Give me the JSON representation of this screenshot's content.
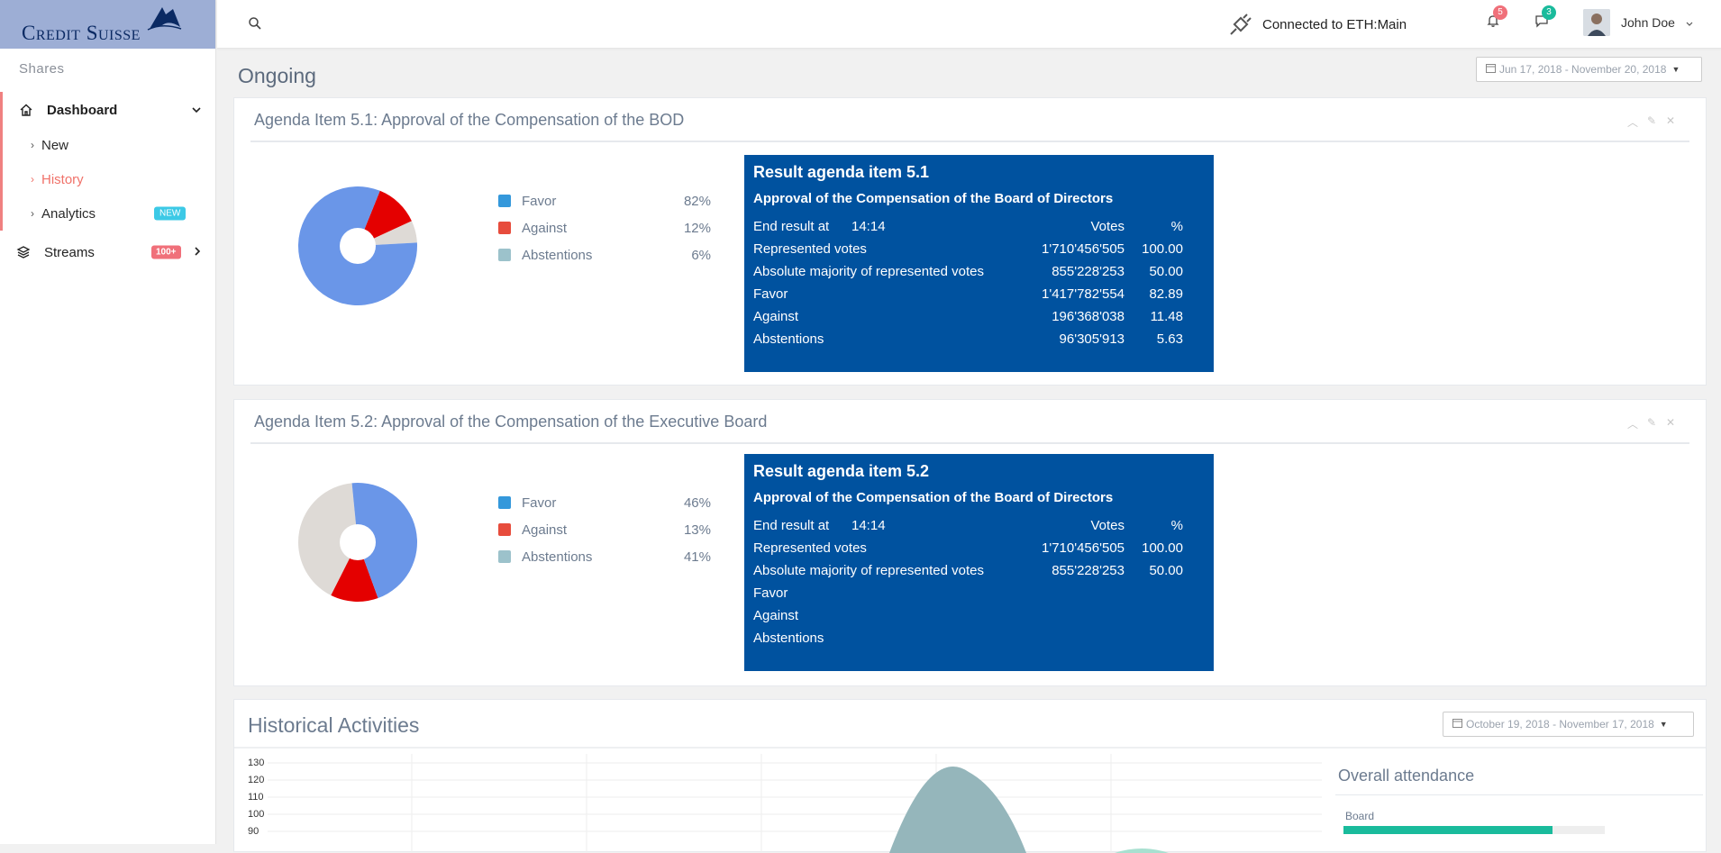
{
  "brand": {
    "name": "Credit Suisse"
  },
  "sidebar": {
    "section": "Shares",
    "dashboard": "Dashboard",
    "items": [
      {
        "label": "New"
      },
      {
        "label": "History"
      },
      {
        "label": "Analytics",
        "badge": "NEW"
      }
    ],
    "streams": {
      "label": "Streams",
      "badge": "100+"
    }
  },
  "topbar": {
    "connection": "Connected to ETH:Main",
    "notifications": "5",
    "messages": "3",
    "user": "John Doe"
  },
  "main": {
    "title": "Ongoing",
    "date_range": "Jun 17, 2018 - November 20, 2018"
  },
  "panels": [
    {
      "title": "Agenda Item 5.1: Approval of the Compensation of the BOD",
      "legend": [
        {
          "label": "Favor",
          "pct": "82%",
          "color": "#3498db"
        },
        {
          "label": "Against",
          "pct": "12%",
          "color": "#e74c3c"
        },
        {
          "label": "Abstentions",
          "pct": "6%",
          "color": "#9cc2cb"
        }
      ],
      "result": {
        "heading": "Result agenda item 5.1",
        "subheading": "Approval of the Compensation of the Board of Directors",
        "end_label": "End result at",
        "end_time": "14:14",
        "votes_header": "Votes",
        "pct_header": "%",
        "rows": [
          {
            "label": "Represented votes",
            "votes": "1'710'456'505",
            "pct": "100.00"
          },
          {
            "label": "Absolute majority of represented votes",
            "votes": "855'228'253",
            "pct": "50.00"
          },
          {
            "label": "Favor",
            "votes": "1'417'782'554",
            "pct": "82.89"
          },
          {
            "label": "Against",
            "votes": "196'368'038",
            "pct": "11.48"
          },
          {
            "label": "Abstentions",
            "votes": "96'305'913",
            "pct": "5.63"
          }
        ]
      }
    },
    {
      "title": "Agenda Item 5.2: Approval of the Compensation of the Executive Board",
      "legend": [
        {
          "label": "Favor",
          "pct": "46%",
          "color": "#3498db"
        },
        {
          "label": "Against",
          "pct": "13%",
          "color": "#e74c3c"
        },
        {
          "label": "Abstentions",
          "pct": "41%",
          "color": "#9cc2cb"
        }
      ],
      "result": {
        "heading": "Result agenda item 5.2",
        "subheading": "Approval of the Compensation of the Board of Directors",
        "end_label": "End result at",
        "end_time": "14:14",
        "votes_header": "Votes",
        "pct_header": "%",
        "rows": [
          {
            "label": "Represented votes",
            "votes": "1'710'456'505",
            "pct": "100.00"
          },
          {
            "label": "Absolute majority of represented votes",
            "votes": "855'228'253",
            "pct": "50.00"
          },
          {
            "label": "Favor",
            "votes": "",
            "pct": ""
          },
          {
            "label": "Against",
            "votes": "",
            "pct": ""
          },
          {
            "label": "Abstentions",
            "votes": "",
            "pct": ""
          }
        ]
      }
    }
  ],
  "historical": {
    "title": "Historical Activities",
    "date_range": "October 19, 2018 - November 17, 2018",
    "yticks": [
      "130",
      "120",
      "110",
      "100",
      "90"
    ],
    "attendance_title": "Overall attendance",
    "board_label": "Board",
    "board_fraction": 0.8
  },
  "colors": {
    "pie_blue": "#6a96e8",
    "pie_red": "#e40000",
    "pie_grey": "#dedad6",
    "result_bg": "#00529f",
    "accent": "#f0726a"
  }
}
